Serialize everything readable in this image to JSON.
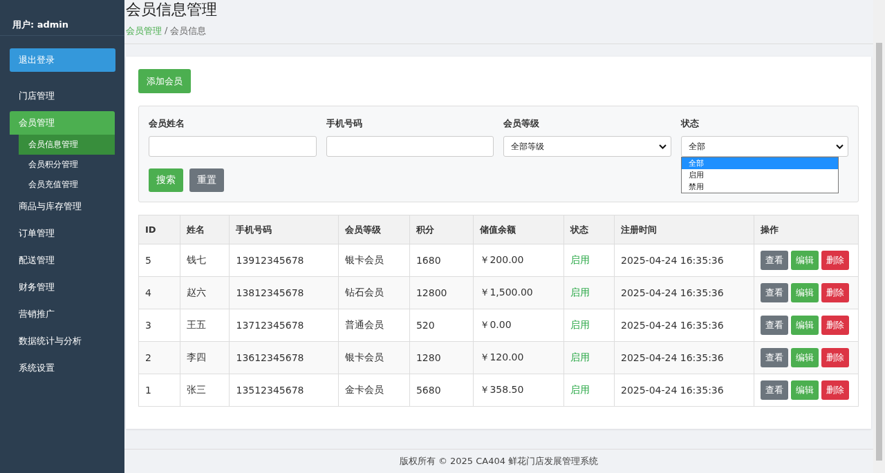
{
  "sidebar": {
    "user": "用户: admin",
    "logout": "退出登录",
    "items": [
      {
        "label": "门店管理",
        "selected": false
      },
      {
        "label": "会员管理",
        "selected": true,
        "children": [
          {
            "label": "会员信息管理",
            "selected": true
          },
          {
            "label": "会员积分管理",
            "selected": false
          },
          {
            "label": "会员充值管理",
            "selected": false
          }
        ]
      },
      {
        "label": "商品与库存管理",
        "selected": false
      },
      {
        "label": "订单管理",
        "selected": false
      },
      {
        "label": "配送管理",
        "selected": false
      },
      {
        "label": "财务管理",
        "selected": false
      },
      {
        "label": "营销推广",
        "selected": false
      },
      {
        "label": "数据统计与分析",
        "selected": false
      },
      {
        "label": "系统设置",
        "selected": false
      }
    ]
  },
  "page": {
    "title": "会员信息管理",
    "breadcrumb": [
      {
        "label": "会员管理",
        "link": true
      },
      {
        "label": "会员信息",
        "link": false
      }
    ],
    "separator": "/"
  },
  "add_button": "添加会员",
  "filters": [
    {
      "label": "会员姓名",
      "kind": "text"
    },
    {
      "label": "手机号码",
      "kind": "text"
    },
    {
      "label": "会员等级",
      "kind": "select",
      "value": "全部等级",
      "expanded": false
    },
    {
      "label": "状态",
      "kind": "select",
      "value": "全部",
      "expanded": true,
      "options": [
        {
          "label": "全部",
          "selected": true
        },
        {
          "label": "启用",
          "selected": false
        },
        {
          "label": "禁用",
          "selected": false
        }
      ]
    }
  ],
  "search_button": "搜索",
  "reset_button": "重置",
  "table": {
    "columns": [
      "ID",
      "姓名",
      "手机号码",
      "会员等级",
      "积分",
      "储值余额",
      "状态",
      "注册时间",
      "操作"
    ],
    "rows": [
      {
        "cells": [
          "5",
          "钱七",
          "13912345678",
          "银卡会员",
          "1680",
          "￥200.00"
        ],
        "status": "启用",
        "time": "2025-04-24 16:35:36",
        "actions": [
          {
            "label": "查看",
            "kind": "view"
          },
          {
            "label": "编辑",
            "kind": "edit"
          },
          {
            "label": "删除",
            "kind": "delete"
          }
        ]
      },
      {
        "cells": [
          "4",
          "赵六",
          "13812345678",
          "钻石会员",
          "12800",
          "￥1,500.00"
        ],
        "status": "启用",
        "time": "2025-04-24 16:35:36",
        "actions": [
          {
            "label": "查看",
            "kind": "view"
          },
          {
            "label": "编辑",
            "kind": "edit"
          },
          {
            "label": "删除",
            "kind": "delete"
          }
        ]
      },
      {
        "cells": [
          "3",
          "王五",
          "13712345678",
          "普通会员",
          "520",
          "￥0.00"
        ],
        "status": "启用",
        "time": "2025-04-24 16:35:36",
        "actions": [
          {
            "label": "查看",
            "kind": "view"
          },
          {
            "label": "编辑",
            "kind": "edit"
          },
          {
            "label": "删除",
            "kind": "delete"
          }
        ]
      },
      {
        "cells": [
          "2",
          "李四",
          "13612345678",
          "银卡会员",
          "1280",
          "￥120.00"
        ],
        "status": "启用",
        "time": "2025-04-24 16:35:36",
        "actions": [
          {
            "label": "查看",
            "kind": "view"
          },
          {
            "label": "编辑",
            "kind": "edit"
          },
          {
            "label": "删除",
            "kind": "delete"
          }
        ]
      },
      {
        "cells": [
          "1",
          "张三",
          "13512345678",
          "金卡会员",
          "5680",
          "￥358.50"
        ],
        "status": "启用",
        "time": "2025-04-24 16:35:36",
        "actions": [
          {
            "label": "查看",
            "kind": "view"
          },
          {
            "label": "编辑",
            "kind": "edit"
          },
          {
            "label": "删除",
            "kind": "delete"
          }
        ]
      }
    ]
  },
  "footer": "版权所有 © 2025 CA404 鲜花门店发展管理系统"
}
